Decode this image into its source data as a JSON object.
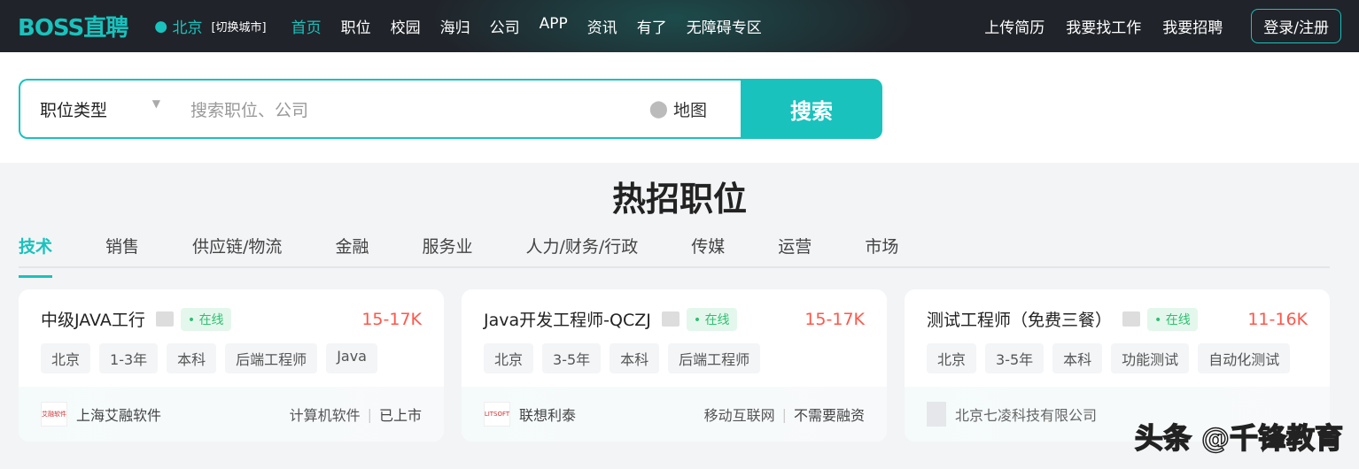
{
  "header": {
    "logo": "BOSS直聘",
    "city": "北京",
    "switch_city": "[切换城市]",
    "nav": [
      "首页",
      "职位",
      "校园",
      "海归",
      "公司",
      "APP",
      "资讯",
      "有了",
      "无障碍专区"
    ],
    "right": [
      "上传简历",
      "我要找工作",
      "我要招聘"
    ],
    "login": "登录/注册"
  },
  "search": {
    "job_type": "职位类型",
    "placeholder": "搜索职位、公司",
    "map": "地图",
    "button": "搜索"
  },
  "section_title": "热招职位",
  "tabs": [
    "技术",
    "销售",
    "供应链/物流",
    "金融",
    "服务业",
    "人力/财务/行政",
    "传媒",
    "运营",
    "市场"
  ],
  "jobs": [
    {
      "title": "中级JAVA工行",
      "status": "在线",
      "salary": "15-17K",
      "tags": [
        "北京",
        "1-3年",
        "本科",
        "后端工程师",
        "Java"
      ],
      "company": "上海艾融软件",
      "logo": "艾融软件",
      "industry": "计算机软件",
      "stage": "已上市"
    },
    {
      "title": "Java开发工程师-QCZJ",
      "status": "在线",
      "salary": "15-17K",
      "tags": [
        "北京",
        "3-5年",
        "本科",
        "后端工程师"
      ],
      "company": "联想利泰",
      "logo": "LITSOFT",
      "industry": "移动互联网",
      "stage": "不需要融资"
    },
    {
      "title": "测试工程师（免费三餐）",
      "status": "在线",
      "salary": "11-16K",
      "tags": [
        "北京",
        "3-5年",
        "本科",
        "功能测试",
        "自动化测试"
      ],
      "company": "北京七凌科技有限公司"
    }
  ],
  "watermark": "头条 @千锋教育"
}
